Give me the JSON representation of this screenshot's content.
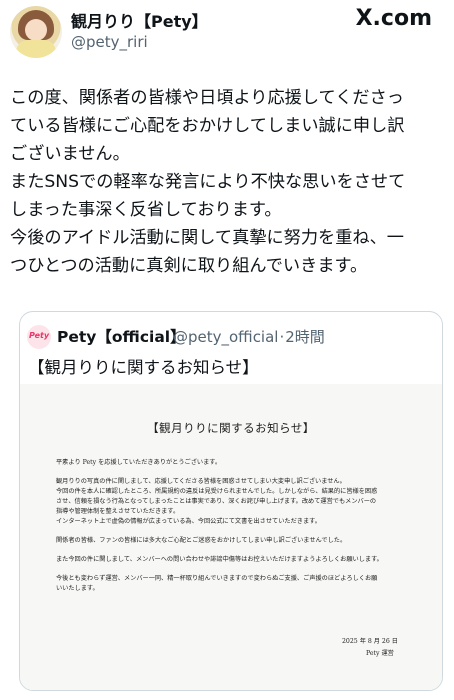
{
  "header": {
    "display_name": "観月りり【Pety】",
    "handle": "@pety_riri",
    "brand": "X.com",
    "avatar_icon": "user-avatar-icon"
  },
  "tweet": {
    "lines": [
      "この度、関係者の皆様や日頃より応援してくださっ",
      "ている皆様にご心配をおかけしてしまい誠に申し訳",
      "ございません。",
      "またSNSでの軽率な発言により不快な思いをさせて",
      "しまった事深く反省しております。",
      "今後のアイドル活動に関して真摯に努力を重ね、一",
      "つひとつの活動に真剣に取り組んでいきます。"
    ]
  },
  "quote": {
    "avatar_text": "Pety",
    "name": "Pety【official】",
    "handle": "@pety_official",
    "separator": "·",
    "time": "2時間",
    "title": "【観月りりに関するお知らせ】",
    "document": {
      "title": "【観月りりに関するお知らせ】",
      "paragraphs": [
        [
          "平素より Pety を応援していただきありがとうございます。"
        ],
        [
          "観月りりの写真の件に関しまして、応援してくださる皆様を困惑させてしまい大変申し訳ございません。",
          "今回の件を本人に確認したところ、所属規約の違反は見受けられませんでした。しかしながら、結果的に皆様を困惑",
          "させ、信頼を損なう行為となってしまったことは事実であり、深くお詫び申し上げます。改めて運営でもメンバーの",
          "指導や管理体制を整えさせていただきます。",
          "インターネット上で虚偽の情報が広まっている為、今回公式にて文書を出させていただきます。"
        ],
        [
          "関係者の皆様、ファンの皆様には多大なご心配とご迷惑をおかけしてしまい申し訳ございませんでした。"
        ],
        [
          "また今回の件に関しまして、メンバーへの問い合わせや誹謗中傷等はお控えいただけますようよろしくお願いします。"
        ],
        [
          "今後とも変わらず運営、メンバー一同、精一杯取り組んでいきますので変わらぬご支援、ご声援のほどよろしくお願",
          "いいたします。"
        ]
      ],
      "date": "2025 年 8 月 26 日",
      "signature": "Pety 運営"
    }
  }
}
